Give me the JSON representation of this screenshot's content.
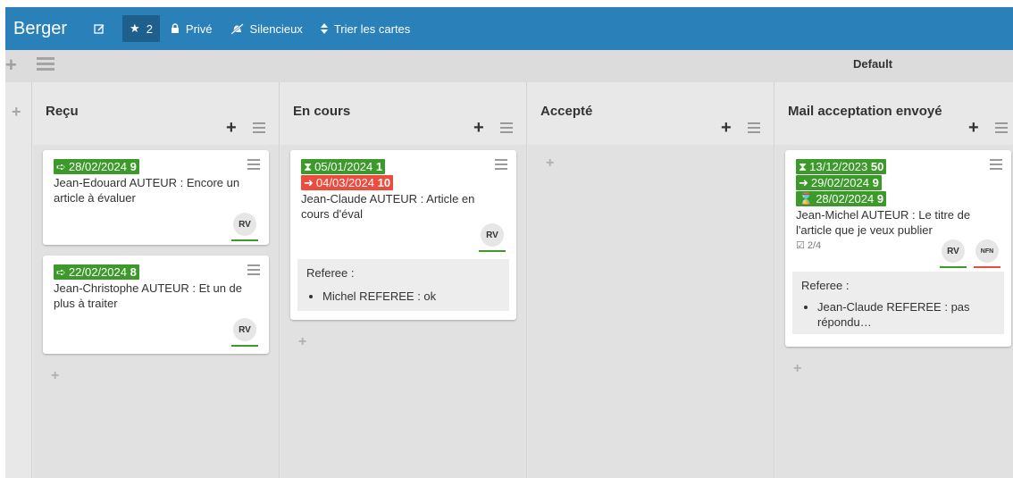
{
  "header": {
    "title": "Berger",
    "edit_icon": "edit-icon",
    "star_count": "2",
    "private_label": "Privé",
    "silent_label": "Silencieux",
    "sort_label": "Trier les cartes"
  },
  "swimlane": {
    "title": "Default"
  },
  "lists": [
    {
      "title": "Reçu",
      "cards": [
        {
          "badges": [
            {
              "color": "green",
              "icon": "received-icon",
              "date": "28/02/2024",
              "count": "9"
            }
          ],
          "text": "Jean-Edouard AUTEUR : Encore un article à évaluer",
          "members": [
            "RV"
          ]
        },
        {
          "badges": [
            {
              "color": "green",
              "icon": "received-icon",
              "date": "22/02/2024",
              "count": "8"
            }
          ],
          "text": "Jean-Christophe AUTEUR : Et un de plus à traiter",
          "members": [
            "RV"
          ]
        }
      ]
    },
    {
      "title": "En cours",
      "cards": [
        {
          "badges": [
            {
              "color": "green",
              "icon": "hourglass-icon",
              "date": "05/01/2024",
              "count": "1"
            },
            {
              "color": "red",
              "icon": "sign-in-icon",
              "date": "04/03/2024",
              "count": "10"
            }
          ],
          "text": "Jean-Claude AUTEUR : Article en cours d'éval",
          "members": [
            "RV"
          ],
          "referee_label": "Referee :",
          "referees": [
            "Michel REFEREE : ok"
          ]
        }
      ]
    },
    {
      "title": "Accepté",
      "cards": []
    },
    {
      "title": "Mail acceptation envoyé",
      "cards": [
        {
          "badges": [
            {
              "color": "green",
              "icon": "hourglass-icon",
              "date": "13/12/2023",
              "count": "50"
            },
            {
              "color": "green",
              "icon": "sign-in-icon",
              "date": "29/02/2024",
              "count": "9"
            },
            {
              "color": "green",
              "icon": "hourglass-end-icon",
              "date": "28/02/2024",
              "count": "9"
            }
          ],
          "text": "Jean-Michel AUTEUR : Le titre de l'article que je veux publier",
          "checklist": "2/4",
          "members": [
            "RV",
            "NFN"
          ],
          "referee_label": "Referee :",
          "referees": [
            "Jean-Claude REFEREE : pas répondu…"
          ]
        }
      ]
    }
  ],
  "colors": {
    "header_bg": "#2a80b9",
    "badge_green": "#3c9a2a",
    "badge_red": "#ec4b3e"
  }
}
